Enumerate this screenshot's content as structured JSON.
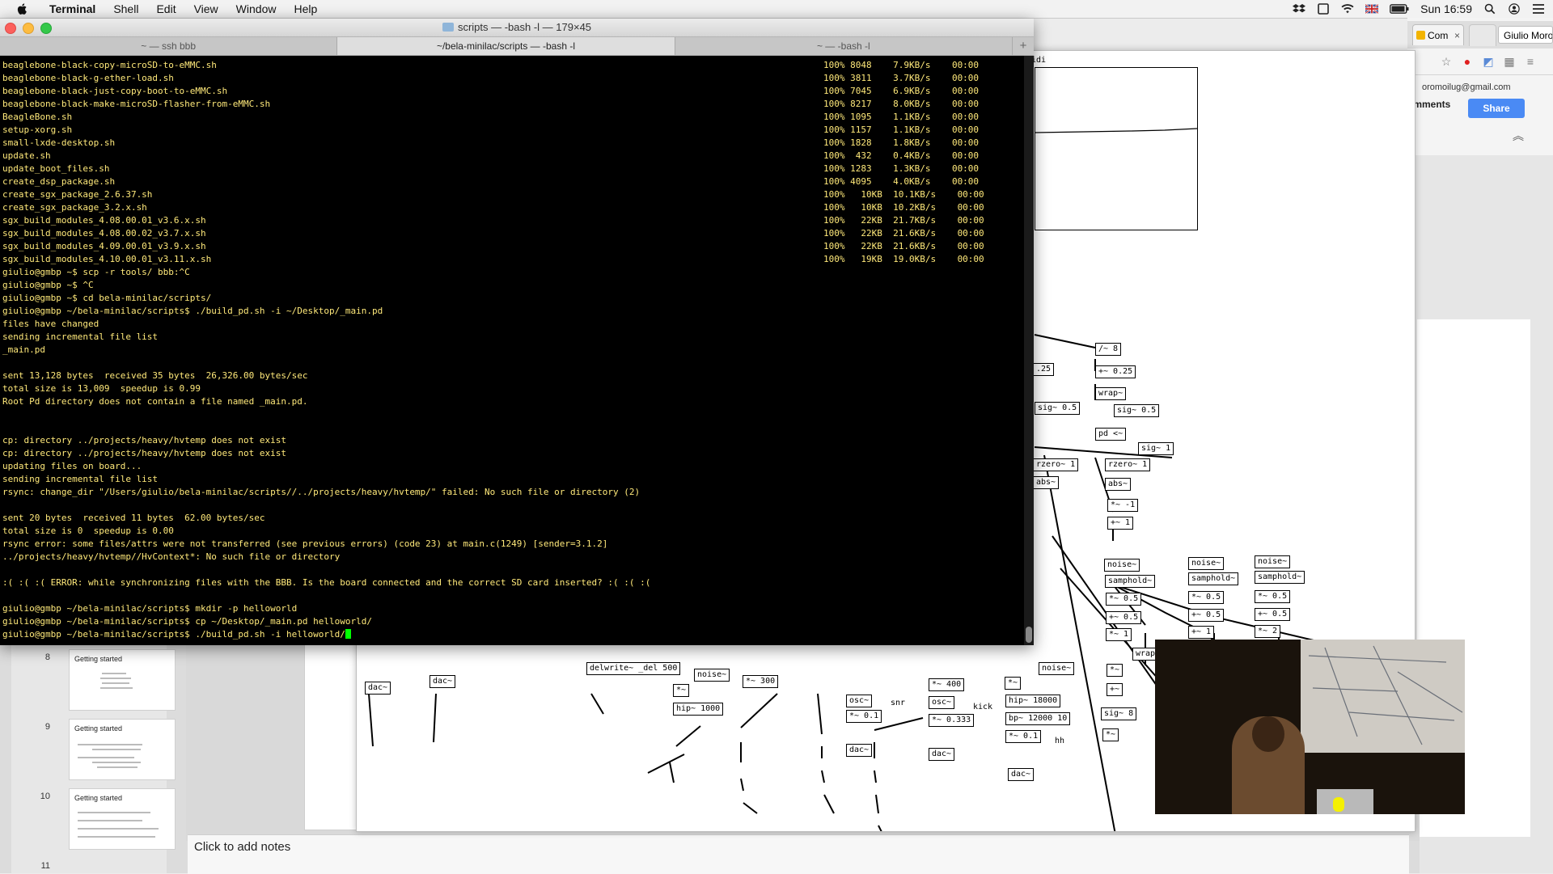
{
  "menubar": {
    "apple": "",
    "app": "Terminal",
    "items": [
      "Shell",
      "Edit",
      "View",
      "Window",
      "Help"
    ],
    "clock": "Sun 16:59"
  },
  "terminal": {
    "title": "scripts — -bash -l — 179×45",
    "tabs": [
      "~ — ssh bbb",
      "~/bela-minilac/scripts — -bash -l",
      "~ — -bash -l"
    ],
    "lines": [
      "beaglebone-black-copy-microSD-to-eMMC.sh",
      "beaglebone-black-g-ether-load.sh",
      "beaglebone-black-just-copy-boot-to-eMMC.sh",
      "beaglebone-black-make-microSD-flasher-from-eMMC.sh",
      "BeagleBone.sh",
      "setup-xorg.sh",
      "small-lxde-desktop.sh",
      "update.sh",
      "update_boot_files.sh",
      "create_dsp_package.sh",
      "create_sgx_package_2.6.37.sh",
      "create_sgx_package_3.2.x.sh",
      "sgx_build_modules_4.08.00.01_v3.6.x.sh",
      "sgx_build_modules_4.08.00.02_v3.7.x.sh",
      "sgx_build_modules_4.09.00.01_v3.9.x.sh",
      "sgx_build_modules_4.10.00.01_v3.11.x.sh",
      "giulio@gmbp ~$ scp -r tools/ bbb:^C",
      "giulio@gmbp ~$ ^C",
      "giulio@gmbp ~$ cd bela-minilac/scripts/",
      "giulio@gmbp ~/bela-minilac/scripts$ ./build_pd.sh -i ~/Desktop/_main.pd",
      "files have changed",
      "sending incremental file list",
      "_main.pd",
      "",
      "sent 13,128 bytes  received 35 bytes  26,326.00 bytes/sec",
      "total size is 13,009  speedup is 0.99",
      "Root Pd directory does not contain a file named _main.pd.",
      "",
      "",
      "cp: directory ../projects/heavy/hvtemp does not exist",
      "cp: directory ../projects/heavy/hvtemp does not exist",
      "updating files on board...",
      "sending incremental file list",
      "rsync: change_dir \"/Users/giulio/bela-minilac/scripts//../projects/heavy/hvtemp/\" failed: No such file or directory (2)",
      "",
      "sent 20 bytes  received 11 bytes  62.00 bytes/sec",
      "total size is 0  speedup is 0.00",
      "rsync error: some files/attrs were not transferred (see previous errors) (code 23) at main.c(1249) [sender=3.1.2]",
      "../projects/heavy/hvtemp//HvContext*: No such file or directory",
      "",
      ":( :( :( ERROR: while synchronizing files with the BBB. Is the board connected and the correct SD card inserted? :( :( :(",
      "",
      "giulio@gmbp ~/bela-minilac/scripts$ mkdir -p helloworld",
      "giulio@gmbp ~/bela-minilac/scripts$ cp ~/Desktop/_main.pd helloworld/",
      "giulio@gmbp ~/bela-minilac/scripts$ ./build_pd.sh -i helloworld/"
    ],
    "transfers": [
      "100% 8048    7.9KB/s    00:00",
      "100% 3811    3.7KB/s    00:00",
      "100% 7045    6.9KB/s    00:00",
      "100% 8217    8.0KB/s    00:00",
      "100% 1095    1.1KB/s    00:00",
      "100% 1157    1.1KB/s    00:00",
      "100% 1828    1.8KB/s    00:00",
      "100%  432    0.4KB/s    00:00",
      "100% 1283    1.3KB/s    00:00",
      "100% 4095    4.0KB/s    00:00",
      "100%   10KB  10.1KB/s    00:00",
      "100%   10KB  10.2KB/s    00:00",
      "100%   22KB  21.7KB/s    00:00",
      "100%   22KB  21.6KB/s    00:00",
      "100%   22KB  21.6KB/s    00:00",
      "100%   19KB  19.0KB/s    00:00"
    ]
  },
  "chrome": {
    "tab_label": "Com",
    "user": "Giulio Moro",
    "email": "oromoilug@gmail.com",
    "comments": "omments",
    "share": "Share"
  },
  "keynote": {
    "slides": [
      {
        "num": "8",
        "title": "Getting started"
      },
      {
        "num": "9",
        "title": "Getting started"
      },
      {
        "num": "10",
        "title": "Getting started"
      },
      {
        "num": "11",
        "title": ""
      }
    ],
    "notes_placeholder": "Click to add notes"
  },
  "pd": {
    "midi_label": "midi",
    "objects": [
      "/~ 8",
      "+~ 0.25",
      "wrap~",
      "sig~ 0.5",
      "pd <~",
      "sig~ 1",
      "rzero~ 1",
      "abs~",
      "*~ -1",
      "+~ 1",
      ".25",
      "sig~ 0.5",
      "rzero~ 1",
      "abs~",
      "noise~",
      "samphold~",
      "noise~",
      "samphold~",
      "noise~",
      "samphold~",
      "*~ 0.5",
      "+~ 0.5",
      "*~ 0.5",
      "+~ 0.5",
      "*~ 0.5",
      "+~ 0.5",
      "*~ 1",
      "+~ 1",
      "*~ 2",
      "wrap~",
      "*~",
      "+~",
      "sig~ 8",
      "*~",
      "dac~",
      "dac~",
      "delwrite~ _del 500",
      "noise~",
      "*~",
      "*~ 300",
      "hip~ 1000",
      "osc~",
      "*~ 0.1",
      "dac~",
      "*~ 400",
      "osc~",
      "*~ 0.333",
      "dac~",
      "noise~",
      "*~",
      "hip~ 18000",
      "bp~ 12000 10",
      "*~ 0.1",
      "dac~"
    ],
    "labels": [
      "snr",
      "kick",
      "hh"
    ]
  },
  "colors": {
    "terminal_text": "#ffe97a",
    "terminal_bg": "#000000",
    "cursor": "#00ff00",
    "share_button": "#4a8af4"
  }
}
